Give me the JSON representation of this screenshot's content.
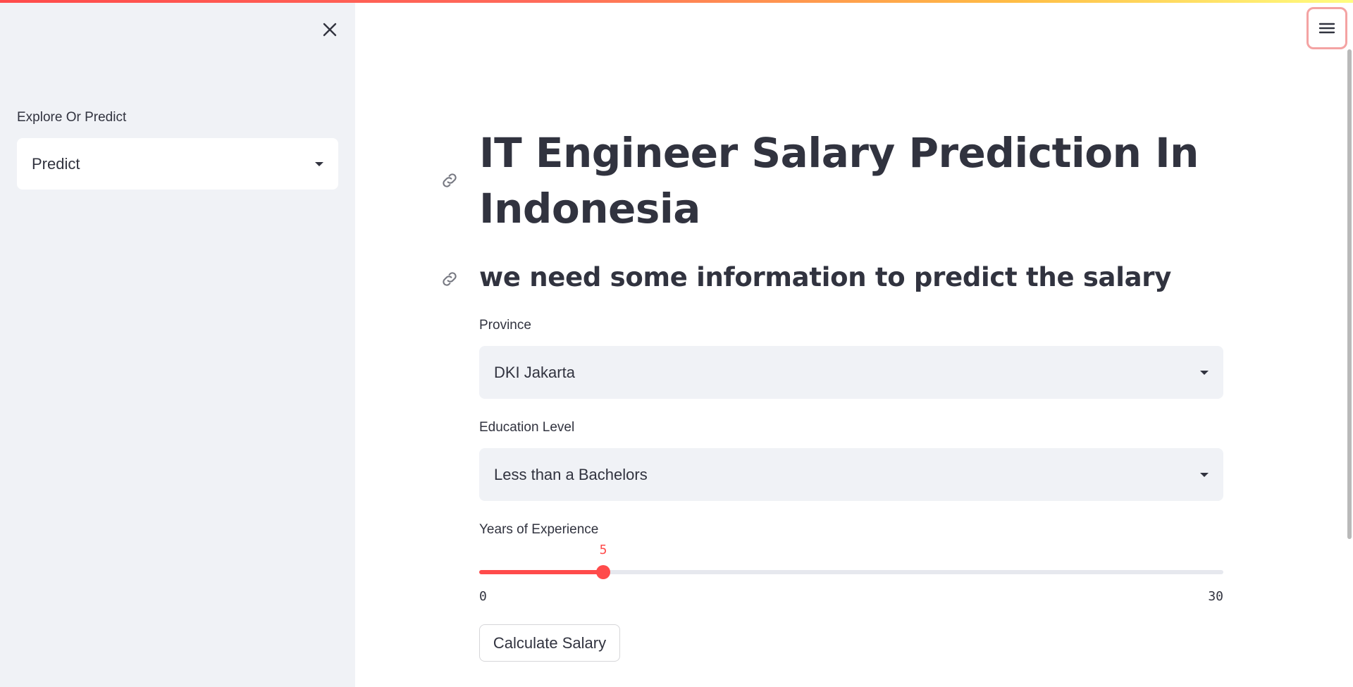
{
  "sidebar": {
    "close_icon": "close-icon",
    "select_label": "Explore Or Predict",
    "select_value": "Predict"
  },
  "header": {
    "menu_icon": "hamburger-menu-icon"
  },
  "main": {
    "title": "IT Engineer Salary Prediction In Indonesia",
    "subtitle": "we need some information to predict the salary",
    "province": {
      "label": "Province",
      "value": "DKI Jakarta"
    },
    "education": {
      "label": "Education Level",
      "value": "Less than a Bachelors"
    },
    "experience": {
      "label": "Years of Experience",
      "value": 5,
      "min": 0,
      "max": 30
    },
    "calculate_label": "Calculate Salary"
  },
  "colors": {
    "accent": "#ff4b4b",
    "sidebar_bg": "#f0f2f6",
    "text": "#31333f"
  }
}
